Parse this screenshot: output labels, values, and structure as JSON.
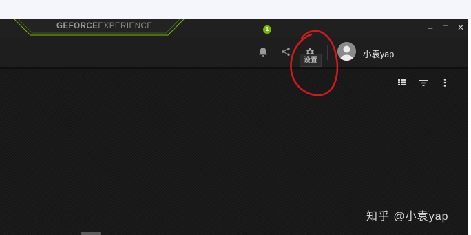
{
  "app": {
    "brand_bold": "GEFORCE",
    "brand_light": "EXPERIENCE"
  },
  "window_controls": {
    "minimize": "–",
    "maximize": "□",
    "close": "✕"
  },
  "header": {
    "notification_count": "1",
    "username": "小袁yap",
    "settings_tooltip": "设置"
  },
  "icons": {
    "bell": "bell-icon",
    "share": "share-icon",
    "settings": "gear-icon",
    "avatar": "user-avatar",
    "view": "grid-view-icon",
    "filter": "filter-icon",
    "more": "more-vertical-icon"
  },
  "watermark": "知乎 @小袁yap",
  "colors": {
    "accent": "#76b900",
    "annotation": "#d11a1a",
    "window_bg": "#1b1b1b"
  }
}
